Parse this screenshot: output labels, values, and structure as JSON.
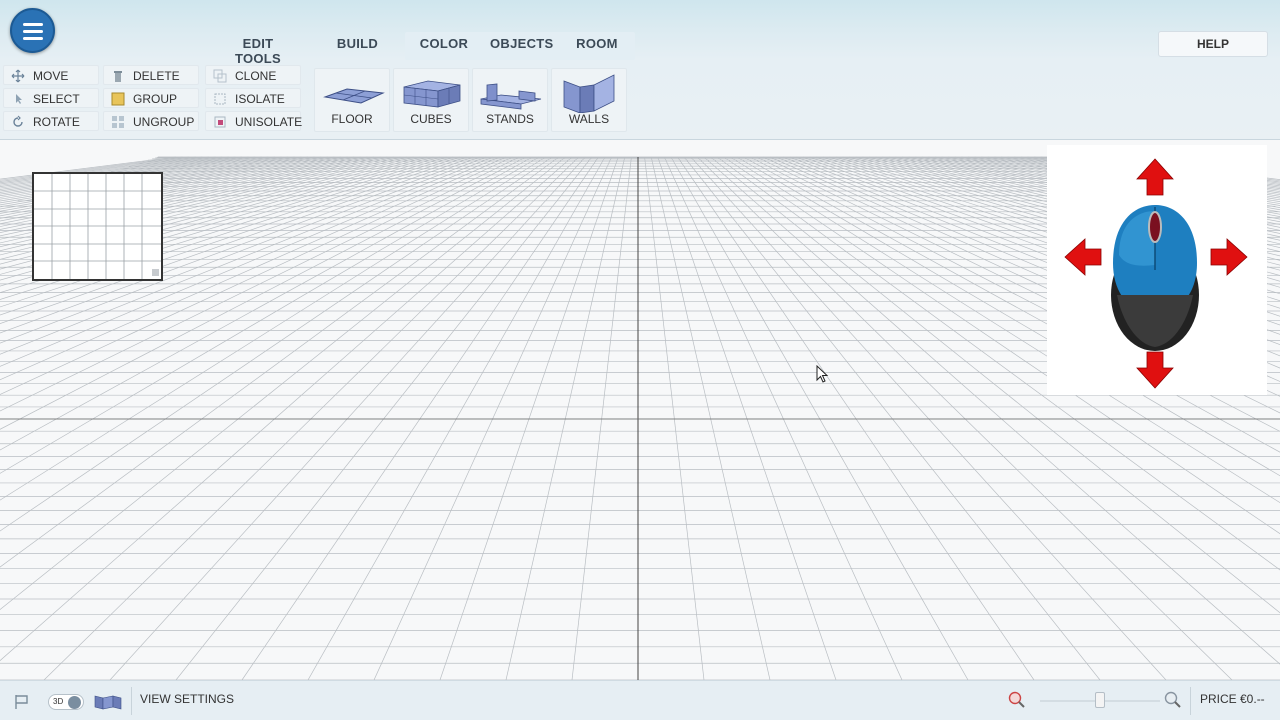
{
  "tabs": {
    "edit_tools": "EDIT TOOLS",
    "build": "BUILD",
    "color": "COLOR",
    "objects": "OBJECTS",
    "room": "ROOM"
  },
  "help_label": "HELP",
  "tools": {
    "move": "MOVE",
    "select": "SELECT",
    "rotate": "ROTATE",
    "delete": "DELETE",
    "group": "GROUP",
    "ungroup": "UNGROUP",
    "clone": "CLONE",
    "isolate": "ISOLATE",
    "unisolate": "UNISOLATE"
  },
  "build_items": {
    "floor": "FLOOR",
    "cubes": "CUBES",
    "stands": "STANDS",
    "walls": "WALLS"
  },
  "bottom": {
    "mode_label": "3D",
    "view_settings": "VIEW SETTINGS",
    "zoom_level": 0.5,
    "price": "PRICE €0.--"
  },
  "colors": {
    "accent": "#2a72b5",
    "arrow_red": "#e01010",
    "mouse_blue": "#1e7fc0"
  },
  "icons": [
    "menu-icon",
    "move-icon",
    "select-icon",
    "rotate-icon",
    "delete-icon",
    "group-icon",
    "ungroup-icon",
    "clone-icon",
    "isolate-icon",
    "unisolate-icon",
    "floor-icon",
    "cubes-icon",
    "stands-icon",
    "walls-icon",
    "mouse-icon",
    "zoom-out-icon",
    "zoom-in-icon",
    "cursor-icon"
  ]
}
